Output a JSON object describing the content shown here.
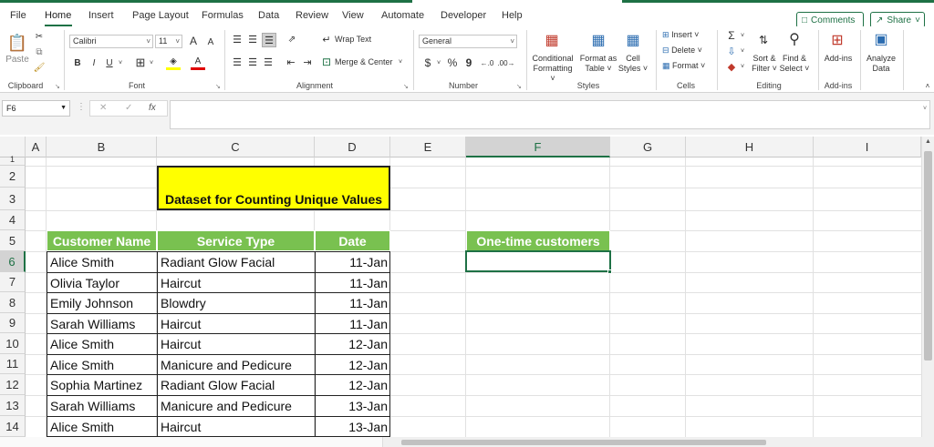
{
  "tabs": [
    "File",
    "Home",
    "Insert",
    "Page Layout",
    "Formulas",
    "Data",
    "Review",
    "View",
    "Automate",
    "Developer",
    "Help"
  ],
  "active_tab": "Home",
  "top_buttons": {
    "comments": "Comments",
    "share": "Share"
  },
  "ribbon": {
    "clipboard": {
      "paste": "Paste",
      "label": "Clipboard"
    },
    "font": {
      "name": "Calibri",
      "size": "11",
      "grow": "A",
      "shrink": "A",
      "bold": "B",
      "italic": "I",
      "underline": "U",
      "label": "Font"
    },
    "alignment": {
      "wrap": "Wrap Text",
      "merge": "Merge & Center",
      "label": "Alignment"
    },
    "number": {
      "format": "General",
      "currency": "$",
      "percent": "%",
      "comma": "9",
      "label": "Number"
    },
    "styles": {
      "conditional1": "Conditional",
      "conditional2": "Formatting",
      "format_table1": "Format as",
      "format_table2": "Table",
      "cell_styles1": "Cell",
      "cell_styles2": "Styles",
      "label": "Styles"
    },
    "cells": {
      "insert": "Insert",
      "delete": "Delete",
      "format": "Format",
      "label": "Cells"
    },
    "editing": {
      "sort1": "Sort &",
      "sort2": "Filter",
      "find1": "Find &",
      "find2": "Select",
      "label": "Editing"
    },
    "addins": {
      "addins": "Add-ins",
      "label": "Add-ins"
    },
    "analyze": {
      "line1": "Analyze",
      "line2": "Data"
    }
  },
  "formula_bar": {
    "name_box": "F6",
    "fx": "fx",
    "value": ""
  },
  "columns": [
    "A",
    "B",
    "C",
    "D",
    "E",
    "F",
    "G",
    "H",
    "I"
  ],
  "rows": [
    "1",
    "2",
    "3",
    "4",
    "5",
    "6",
    "7",
    "8",
    "9",
    "10",
    "11",
    "12",
    "13",
    "14"
  ],
  "sheet": {
    "title": "Dataset for Counting Unique Values",
    "headers": [
      "Customer Name",
      "Service Type",
      "Date"
    ],
    "records": [
      [
        "Alice Smith",
        "Radiant Glow Facial",
        "11-Jan"
      ],
      [
        "Olivia Taylor",
        "Haircut",
        "11-Jan"
      ],
      [
        "Emily Johnson",
        "Blowdry",
        "11-Jan"
      ],
      [
        "Sarah Williams",
        "Haircut",
        "11-Jan"
      ],
      [
        "Alice Smith",
        "Haircut",
        "12-Jan"
      ],
      [
        "Alice Smith",
        "Manicure and Pedicure",
        "12-Jan"
      ],
      [
        "Sophia Martinez",
        "Radiant Glow Facial",
        "12-Jan"
      ],
      [
        "Sarah Williams",
        "Manicure and Pedicure",
        "13-Jan"
      ],
      [
        "Alice Smith",
        "Haircut",
        "13-Jan"
      ]
    ],
    "onetime_header": "One-time customers",
    "selected_cell": "F6"
  },
  "colors": {
    "excel_green": "#1e7145",
    "header_green": "#79c150",
    "title_yellow": "#ffff00"
  }
}
